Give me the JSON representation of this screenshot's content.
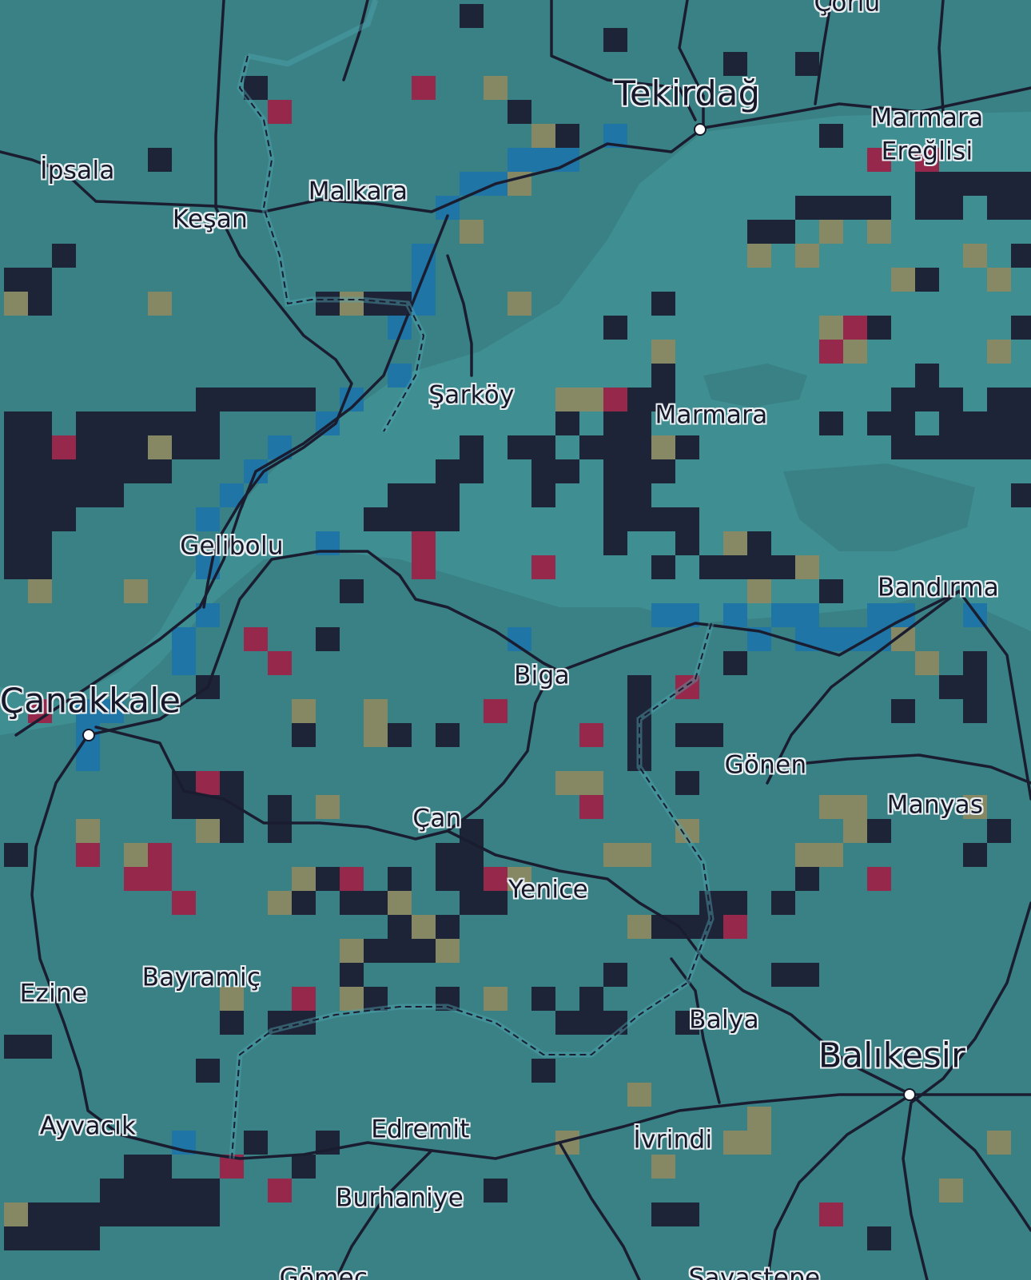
{
  "map": {
    "colors": {
      "water": "#3f8f92",
      "land": "#3a8185",
      "dark_cell": "#1c1f33",
      "crimson_cell": "#9b2348",
      "tan_cell": "#8f8860",
      "blue_cell": "#1e74a8",
      "road": "#1a1d30",
      "border_glow": "#4fa3b0"
    },
    "labels": [
      {
        "id": "corlu",
        "text": "Çorlu",
        "size": "sm"
      },
      {
        "id": "tekirdag",
        "text": "Tekirdağ",
        "size": "big"
      },
      {
        "id": "marmara-ereglisi-1",
        "text": "Marmara",
        "size": "sm"
      },
      {
        "id": "marmara-ereglisi-2",
        "text": "Ereğlisi",
        "size": "sm"
      },
      {
        "id": "ipsala",
        "text": "İpsala",
        "size": "sm"
      },
      {
        "id": "malkara",
        "text": "Malkara",
        "size": "sm"
      },
      {
        "id": "kesan",
        "text": "Keşan",
        "size": "sm"
      },
      {
        "id": "sarkoy",
        "text": "Şarköy",
        "size": "sm"
      },
      {
        "id": "marmara",
        "text": "Marmara",
        "size": "sm"
      },
      {
        "id": "gelibolu",
        "text": "Gelibolu",
        "size": "sm"
      },
      {
        "id": "bandirma",
        "text": "Bandırma",
        "size": "sm"
      },
      {
        "id": "canakkale",
        "text": "Çanakkale",
        "size": "big"
      },
      {
        "id": "biga",
        "text": "Biga",
        "size": "sm"
      },
      {
        "id": "gonen",
        "text": "Gönen",
        "size": "sm"
      },
      {
        "id": "manyas",
        "text": "Manyas",
        "size": "sm"
      },
      {
        "id": "can",
        "text": "Çan",
        "size": "sm"
      },
      {
        "id": "yenice",
        "text": "Yenice",
        "size": "sm"
      },
      {
        "id": "ezine",
        "text": "Ezine",
        "size": "sm"
      },
      {
        "id": "bayramic",
        "text": "Bayramiç",
        "size": "sm"
      },
      {
        "id": "balya",
        "text": "Balya",
        "size": "sm"
      },
      {
        "id": "balikesir",
        "text": "Balıkesir",
        "size": "big"
      },
      {
        "id": "ayvacik",
        "text": "Ayvacık",
        "size": "sm"
      },
      {
        "id": "edremit",
        "text": "Edremit",
        "size": "sm"
      },
      {
        "id": "ivrindi",
        "text": "İvrindi",
        "size": "sm"
      },
      {
        "id": "burhaniye",
        "text": "Burhaniye",
        "size": "sm"
      },
      {
        "id": "gomec",
        "text": "Gömeç",
        "size": "sm"
      },
      {
        "id": "savastepe",
        "text": "Savaştepe",
        "size": "sm"
      }
    ],
    "cities": [
      "tekirdag",
      "canakkale",
      "balikesir"
    ]
  }
}
